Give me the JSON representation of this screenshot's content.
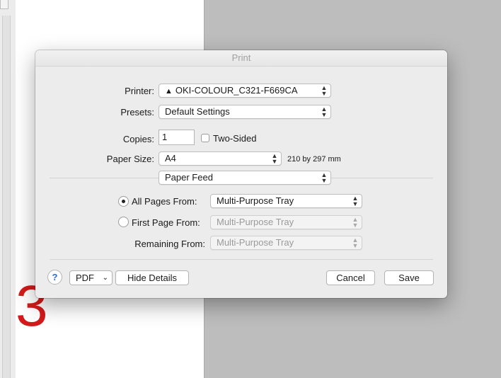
{
  "background": {
    "page_glyph": "3"
  },
  "dialog": {
    "title": "Print",
    "printer": {
      "label": "Printer:",
      "value": "OKI-COLOUR_C321-F669CA",
      "warning_glyph": "▲"
    },
    "presets": {
      "label": "Presets:",
      "value": "Default Settings"
    },
    "copies": {
      "label": "Copies:",
      "value": "1"
    },
    "two_sided": {
      "label": "Two-Sided",
      "checked": false
    },
    "paper_size": {
      "label": "Paper Size:",
      "value": "A4",
      "dimensions": "210 by 297 mm"
    },
    "section_popup": {
      "value": "Paper Feed"
    },
    "all_pages": {
      "label": "All Pages From:",
      "value": "Multi-Purpose Tray",
      "selected": true
    },
    "first_page": {
      "label": "First Page From:",
      "value": "Multi-Purpose Tray",
      "selected": false
    },
    "remaining": {
      "label": "Remaining From:",
      "value": "Multi-Purpose Tray"
    },
    "footer": {
      "help": "?",
      "pdf": "PDF",
      "hide_details": "Hide Details",
      "cancel": "Cancel",
      "save": "Save"
    }
  },
  "colors": {
    "accent": "#2a6fd6",
    "glyph_red": "#d41a1a"
  },
  "icons": {
    "popup_chevron": "up-down-chevron-icon",
    "dropdown": "chevron-down-icon"
  }
}
